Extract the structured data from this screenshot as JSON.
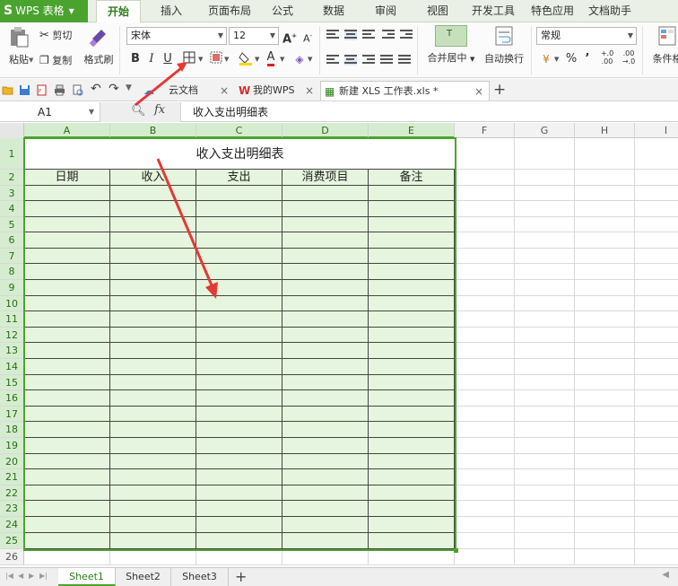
{
  "app": {
    "name": "WPS 表格",
    "logo": "S"
  },
  "menu": {
    "tabs": [
      "开始",
      "插入",
      "页面布局",
      "公式",
      "数据",
      "审阅",
      "视图",
      "开发工具",
      "特色应用",
      "文档助手"
    ],
    "active": "开始"
  },
  "ribbon": {
    "paste": "粘贴",
    "cut": "剪切",
    "copy": "复制",
    "format_painter": "格式刷",
    "font_name": "宋体",
    "font_size": "12",
    "bold": "B",
    "italic": "I",
    "underline": "U",
    "merge_center": "合并居中",
    "wrap_text": "自动换行",
    "number_format": "常规",
    "conditional_format": "条件格",
    "percent": "%",
    "comma": "’"
  },
  "doc_tabs": {
    "cloud": "云文档",
    "mywps": "我的WPS",
    "current": "新建 XLS 工作表.xls *"
  },
  "formula_bar": {
    "cell_ref": "A1",
    "fx": "fx",
    "content": "收入支出明细表"
  },
  "sheet": {
    "columns": [
      "A",
      "B",
      "C",
      "D",
      "E",
      "F",
      "G",
      "H",
      "I"
    ],
    "rows": [
      "1",
      "2",
      "3",
      "4",
      "5",
      "6",
      "7",
      "8",
      "9",
      "10",
      "11",
      "12",
      "13",
      "14",
      "15",
      "16",
      "17",
      "18",
      "19",
      "20",
      "21",
      "22",
      "23",
      "24",
      "25",
      "26"
    ],
    "title": "收入支出明细表",
    "headers": [
      "日期",
      "收入",
      "支出",
      "消费项目",
      "备注"
    ]
  },
  "sheet_tabs": [
    "Sheet1",
    "Sheet2",
    "Sheet3"
  ],
  "active_sheet": "Sheet1",
  "colors": {
    "accent": "#4ba32f",
    "cell_fill": "#e6f5dd",
    "arrow": "#e53935"
  }
}
